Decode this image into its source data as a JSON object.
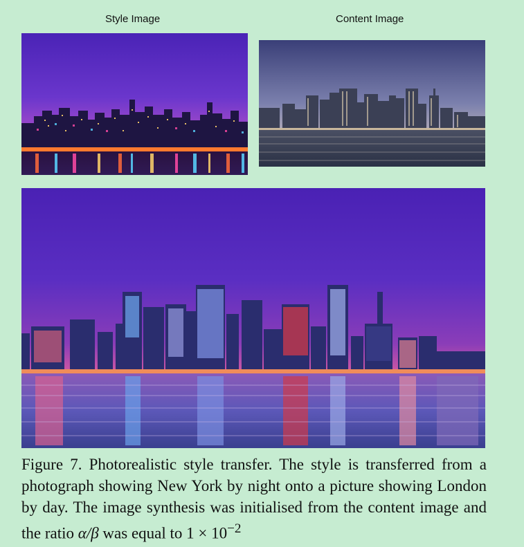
{
  "figure": {
    "style_label": "Style Image",
    "content_label": "Content Image",
    "caption": {
      "prefix": "Figure 7. Photorealistic style transfer. The style is transferred from a photograph showing New York by night onto a picture showing London by day. The image synthesis was initialised from the content image and the ratio ",
      "math_alpha_beta": "α/β",
      "mid": " was equal to 1 × 10",
      "exponent": "−2"
    }
  }
}
